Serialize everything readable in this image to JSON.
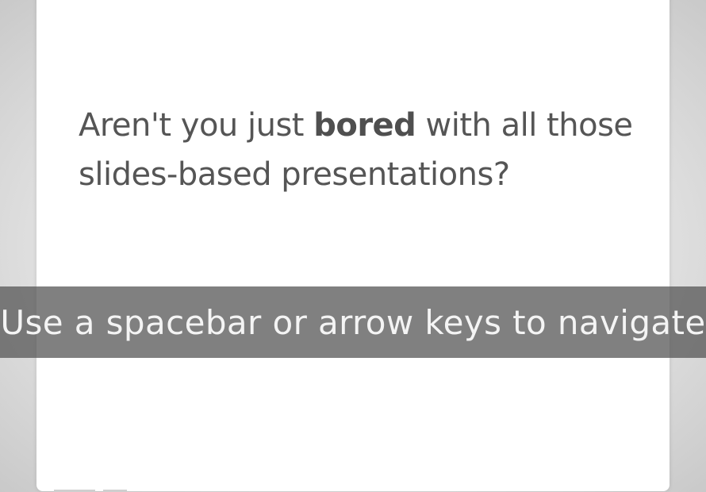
{
  "slide": {
    "text_before": "Aren't you just ",
    "text_bold": "bored",
    "text_after": " with all those slides-based presentations?"
  },
  "hint": {
    "text": "Use a spacebar or arrow keys to navigate"
  }
}
